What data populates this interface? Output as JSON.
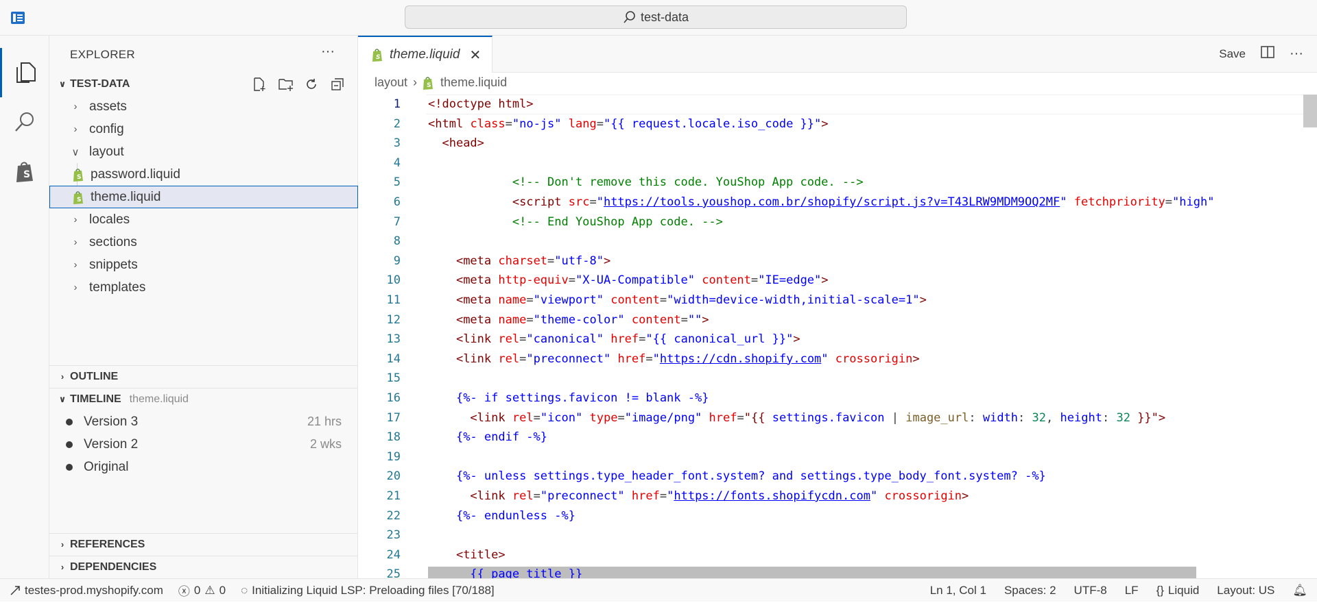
{
  "titlebar": {
    "search_text": "test-data"
  },
  "sidebar": {
    "title": "EXPLORER",
    "root_folder": "TEST-DATA",
    "items": [
      {
        "label": "assets",
        "type": "folder",
        "expanded": false
      },
      {
        "label": "config",
        "type": "folder",
        "expanded": false
      },
      {
        "label": "layout",
        "type": "folder",
        "expanded": true
      },
      {
        "label": "password.liquid",
        "type": "file",
        "selected": false
      },
      {
        "label": "theme.liquid",
        "type": "file",
        "selected": true
      },
      {
        "label": "locales",
        "type": "folder",
        "expanded": false
      },
      {
        "label": "sections",
        "type": "folder",
        "expanded": false
      },
      {
        "label": "snippets",
        "type": "folder",
        "expanded": false
      },
      {
        "label": "templates",
        "type": "folder",
        "expanded": false
      }
    ],
    "outline_label": "OUTLINE",
    "timeline": {
      "label": "TIMELINE",
      "file": "theme.liquid",
      "entries": [
        {
          "label": "Version 3",
          "time": "21 hrs"
        },
        {
          "label": "Version 2",
          "time": "2 wks"
        },
        {
          "label": "Original",
          "time": ""
        }
      ]
    },
    "references_label": "REFERENCES",
    "dependencies_label": "DEPENDENCIES"
  },
  "editor": {
    "tab_label": "theme.liquid",
    "save_label": "Save",
    "breadcrumb": [
      "layout",
      "theme.liquid"
    ],
    "current_line": 1
  },
  "status": {
    "remote": "testes-prod.myshopify.com",
    "errors": "0",
    "warnings": "0",
    "progress": "Initializing Liquid LSP: Preloading files [70/188]",
    "position": "Ln 1, Col 1",
    "spaces": "Spaces: 2",
    "encoding": "UTF-8",
    "eol": "LF",
    "language": "Liquid",
    "layout": "Layout: US"
  },
  "colors": {
    "accent": "#005fb8",
    "shopify_green": "#95bf47"
  }
}
